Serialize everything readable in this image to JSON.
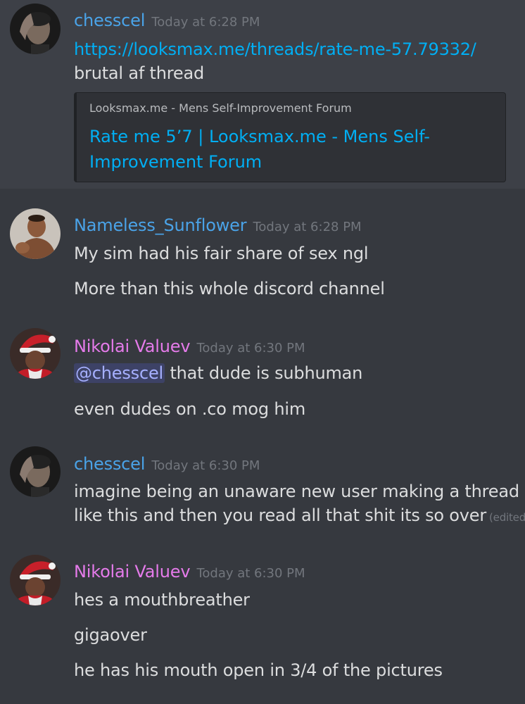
{
  "colors": {
    "background": "#36393f",
    "highlight": "#3d4047",
    "link": "#00aff4",
    "user_chesscel": "#4aa3e8",
    "user_nameless": "#4aa3e8",
    "user_nikolai": "#e57bea",
    "timestamp": "#72767d",
    "text": "#dcddde"
  },
  "messages": [
    {
      "user": "chesscel",
      "timestamp": "Today at 6:28 PM",
      "avatar_icon": "user-avatar-icon",
      "link": "https://looksmax.me/threads/rate-me-57.79332/",
      "text": "brutal af thread",
      "embed": {
        "provider": "Looksmax.me - Mens Self-Improvement Forum",
        "title": "Rate me 5’7 | Looksmax.me - Mens Self-Improvement Forum"
      }
    },
    {
      "user": "Nameless_Sunflower",
      "timestamp": "Today at 6:28 PM",
      "avatar_icon": "user-avatar-icon",
      "lines": [
        "My sim had his fair share of sex ngl",
        "More than this whole discord channel"
      ]
    },
    {
      "user": "Nikolai Valuev",
      "timestamp": "Today at 6:30 PM",
      "avatar_icon": "santa-avatar-icon",
      "mention": "@chesscel",
      "mention_rest": "that dude is subhuman",
      "lines": [
        "even dudes on .co mog him"
      ]
    },
    {
      "user": "chesscel",
      "timestamp": "Today at 6:30 PM",
      "avatar_icon": "user-avatar-icon",
      "lines": [
        "imagine being an unaware new user making a thread",
        "like this and then you read all that shit its so over"
      ],
      "edited": "(edited)"
    },
    {
      "user": "Nikolai Valuev",
      "timestamp": "Today at 6:30 PM",
      "avatar_icon": "santa-avatar-icon",
      "lines": [
        "hes a mouthbreather",
        "gigaover",
        "he has his mouth open in 3/4 of the pictures"
      ]
    }
  ]
}
